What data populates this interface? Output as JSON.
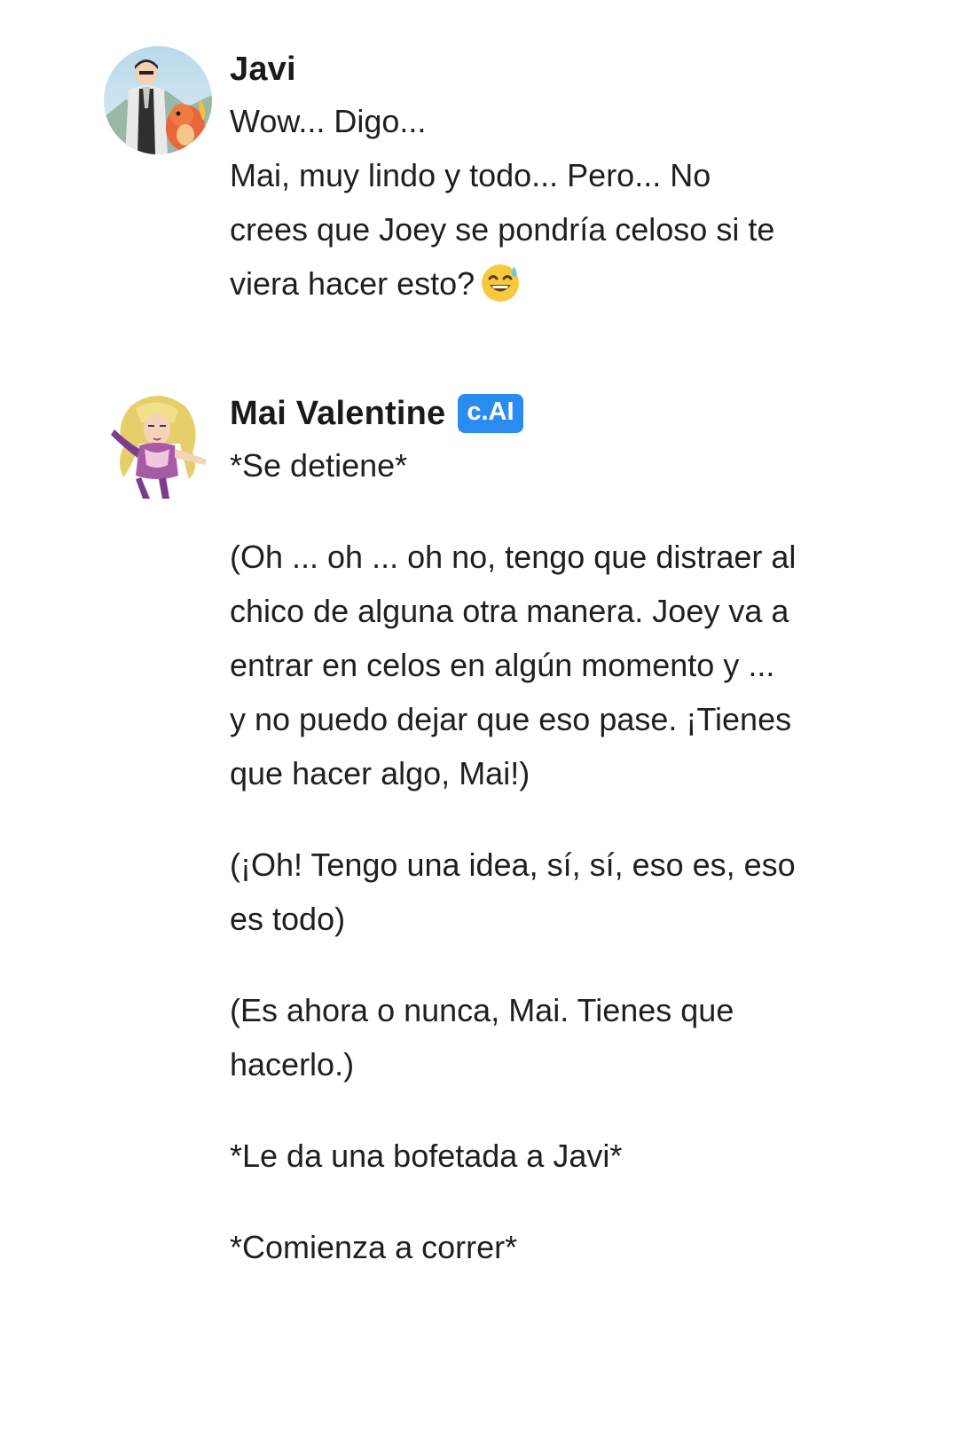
{
  "messages": [
    {
      "author": "Javi",
      "avatar_icon": "user-avatar-icon",
      "lines": [
        "Wow... Digo...",
        "Mai, muy lindo y todo... Pero... No crees que Joey se pondría celoso si te viera hacer esto?"
      ],
      "emoji": "sweat-smile-emoji"
    },
    {
      "author": "Mai Valentine",
      "badge": "c.AI",
      "avatar_icon": "character-avatar-icon",
      "paragraphs": [
        "*Se detiene*",
        "(Oh ... oh ... oh no, tengo que distraer al chico de alguna otra manera. Joey va a entrar en celos en algún momento y ... y no puedo dejar que eso pase. ¡Tienes que hacer algo, Mai!)",
        "(¡Oh! Tengo una idea, sí, sí, eso es, eso es todo)",
        "(Es ahora o nunca, Mai. Tienes que hacerlo.)",
        "*Le da una bofetada a Javi*",
        "*Comienza a correr*"
      ]
    }
  ],
  "colors": {
    "badge": "#2a8cf0",
    "text": "#1f1f1f",
    "background": "#ffffff"
  }
}
